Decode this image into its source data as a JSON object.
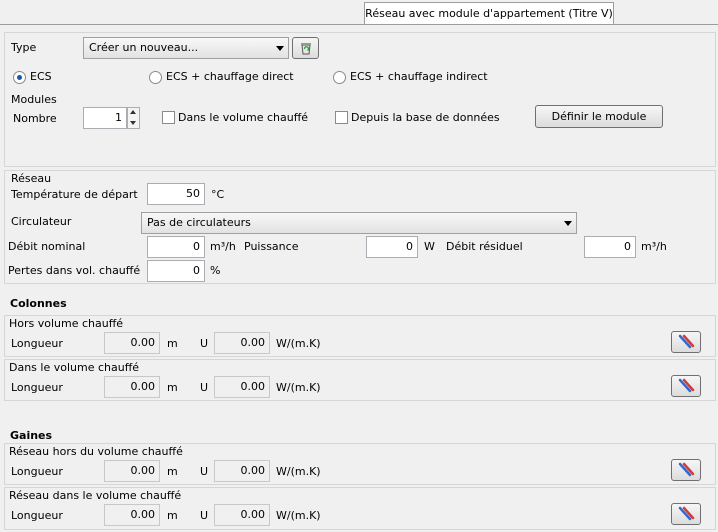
{
  "tab": {
    "label": "Réseau avec module d'appartement (Titre V)"
  },
  "type_row": {
    "label": "Type",
    "combo_value": "Créer un nouveau..."
  },
  "radios": {
    "ecs": "ECS",
    "ecs_direct": "ECS + chauffage direct",
    "ecs_indirect": "ECS + chauffage indirect",
    "selected": "ECS"
  },
  "modules": {
    "title": "Modules",
    "nombre_label": "Nombre",
    "nombre_value": "1",
    "dans_volume_label": "Dans le volume chauffé",
    "depuis_base_label": "Depuis la base de données",
    "definir_button": "Définir le module"
  },
  "reseau": {
    "title": "Réseau",
    "temp_label": "Température de départ",
    "temp_value": "50",
    "temp_unit": "°C",
    "circulateur_label": "Circulateur",
    "circulateur_value": "Pas de circulateurs",
    "debit_nominal_label": "Débit nominal",
    "debit_nominal_value": "0",
    "debit_unit": "m³/h",
    "puissance_label": "Puissance",
    "puissance_value": "0",
    "puissance_unit": "W",
    "debit_residuel_label": "Débit résiduel",
    "debit_residuel_value": "0",
    "debit_residuel_unit": "m³/h",
    "pertes_label": "Pertes dans vol. chauffé",
    "pertes_value": "0",
    "pertes_unit": "%"
  },
  "colonnes": {
    "title": "Colonnes",
    "hors": {
      "title": "Hors volume chauffé",
      "longueur_label": "Longueur",
      "longueur_value": "0.00",
      "m_unit": "m",
      "u_label": "U",
      "u_value": "0.00",
      "u_unit": "W/(m.K)"
    },
    "dans": {
      "title": "Dans le volume chauffé",
      "longueur_label": "Longueur",
      "longueur_value": "0.00",
      "m_unit": "m",
      "u_label": "U",
      "u_value": "0.00",
      "u_unit": "W/(m.K)"
    }
  },
  "gaines": {
    "title": "Gaines",
    "hors": {
      "title": "Réseau hors du volume chauffé",
      "longueur_label": "Longueur",
      "longueur_value": "0.00",
      "m_unit": "m",
      "u_label": "U",
      "u_value": "0.00",
      "u_unit": "W/(m.K)"
    },
    "dans": {
      "title": "Réseau dans le volume chauffé",
      "longueur_label": "Longueur",
      "longueur_value": "0.00",
      "m_unit": "m",
      "u_label": "U",
      "u_value": "0.00",
      "u_unit": "W/(m.K)"
    }
  },
  "icons": {
    "combo_action": "recycle-bin-icon",
    "pipe_picker": "pipe-picker-icon"
  }
}
